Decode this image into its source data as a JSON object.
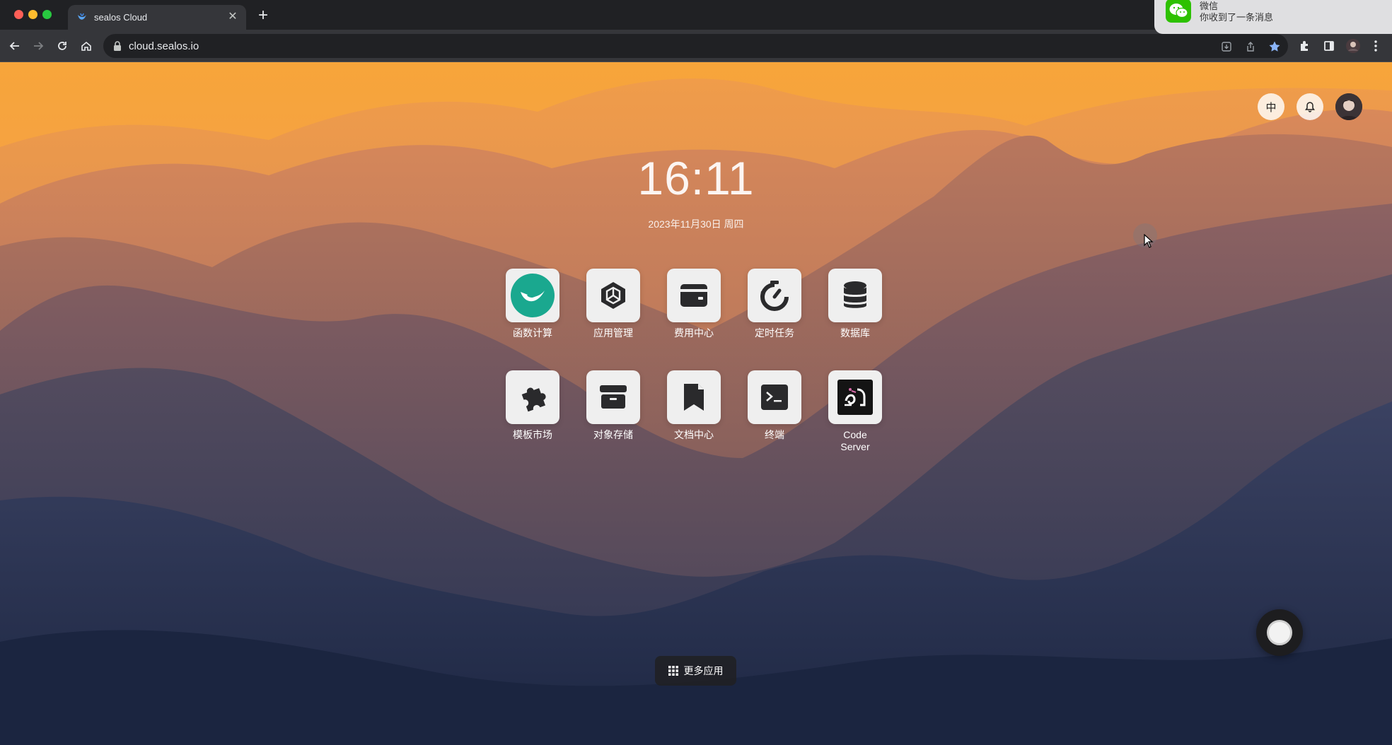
{
  "browser": {
    "tab_title": "sealos Cloud",
    "url": "cloud.sealos.io",
    "icons": [
      "back-icon",
      "forward-icon",
      "reload-icon",
      "home-icon",
      "lock-icon",
      "install-icon",
      "share-icon",
      "bookmark-star-icon",
      "extensions-icon",
      "sidepanel-icon",
      "profile-icon",
      "menu-icon"
    ]
  },
  "notification": {
    "app": "微信",
    "message": "你收到了一条消息"
  },
  "header": {
    "language_label": "中"
  },
  "clock": {
    "time": "16:11",
    "date": "2023年11月30日 周四"
  },
  "apps": [
    {
      "label": "函数计算",
      "icon": "laf-icon"
    },
    {
      "label": "应用管理",
      "icon": "app-launchpad-icon"
    },
    {
      "label": "费用中心",
      "icon": "wallet-icon"
    },
    {
      "label": "定时任务",
      "icon": "timer-icon"
    },
    {
      "label": "数据库",
      "icon": "database-icon"
    },
    {
      "label": "模板市场",
      "icon": "puzzle-icon"
    },
    {
      "label": "对象存储",
      "icon": "storage-icon"
    },
    {
      "label": "文档中心",
      "icon": "doc-icon"
    },
    {
      "label": "终端",
      "icon": "terminal-icon"
    },
    {
      "label": "Code Server",
      "icon": "code-server-icon"
    }
  ],
  "more_apps": {
    "label": "更多应用"
  },
  "colors": {
    "sky_top": "#f7a53a",
    "sky_mid": "#e88c44",
    "ground_bottom": "#1f2a45",
    "laf_teal": "#1aa88f",
    "wechat_green": "#2dc100"
  }
}
